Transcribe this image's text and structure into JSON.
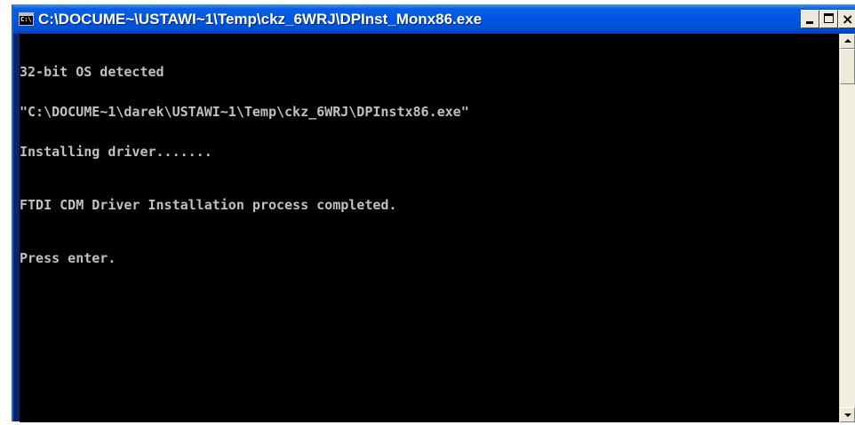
{
  "window": {
    "title": "C:\\DOCUME~\\USTAWI~1\\Temp\\ckz_6WRJ\\DPInst_Monx86.exe",
    "icon": "console-icon",
    "icon_text": "C:\\"
  },
  "controls": {
    "minimize": "minimize-icon",
    "maximize": "maximize-icon",
    "close": "close-icon",
    "close_glyph": "×"
  },
  "console": {
    "lines": [
      "32-bit OS detected",
      "\"C:\\DOCUME~1\\darek\\USTAWI~1\\Temp\\ckz_6WRJ\\DPInstx86.exe\"",
      "Installing driver.......",
      "FTDI CDM Driver Installation process completed.",
      "Press enter."
    ]
  },
  "colors": {
    "titlebar_blue": "#0055e5",
    "console_background": "#000000",
    "console_text": "#c0c0c0"
  }
}
